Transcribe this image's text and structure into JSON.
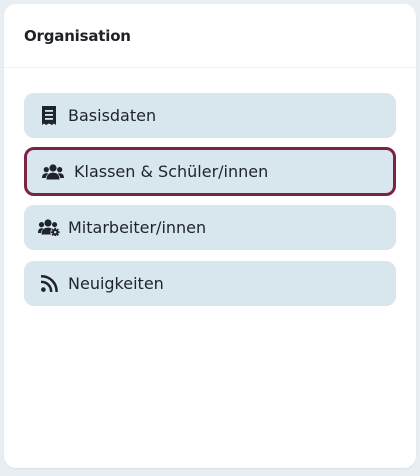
{
  "panel": {
    "title": "Organisation"
  },
  "menu": {
    "items": [
      {
        "label": "Basisdaten",
        "icon": "receipt-icon",
        "active": false
      },
      {
        "label": "Klassen & Schüler/innen",
        "icon": "users-icon",
        "active": true
      },
      {
        "label": "Mitarbeiter/innen",
        "icon": "users-cog-icon",
        "active": false
      },
      {
        "label": "Neuigkeiten",
        "icon": "rss-icon",
        "active": false
      }
    ]
  },
  "colors": {
    "background": "#e9eef3",
    "panel": "#ffffff",
    "item_background": "#d8e6ee",
    "active_border": "#7c2343",
    "text": "#1e2429"
  }
}
